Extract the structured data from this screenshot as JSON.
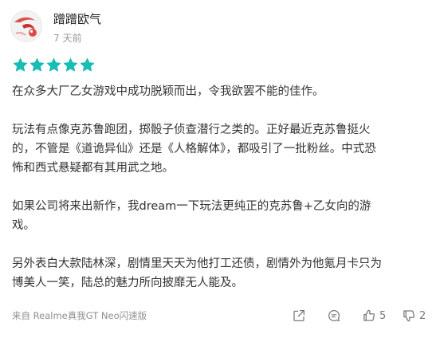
{
  "review": {
    "username": "蹭蹭欧气",
    "time": "7 天前",
    "rating": 5,
    "star_color": "#19bdb5",
    "paragraphs": [
      "在众多大厂乙女游戏中成功脱颖而出，令我欲罢不能的佳作。",
      "玩法有点像克苏鲁跑团，掷骰子侦查潜行之类的。正好最近克苏鲁挺火\n的，不管是《道诡异仙》还是《人格解体》，都吸引了一批粉丝。中式恐\n怖和西式悬疑都有其用武之地。",
      "如果公司将来出新作，我dream一下玩法更纯正的克苏鲁+乙女向的游\n戏。",
      "另外表白大款陆林深，剧情里天天为他打工还债，剧情外为他氪月卡只为\n博美人一笑，陆总的魅力所向披靡无人能及。"
    ],
    "device": "来自 Realme真我GT Neo闪速版",
    "actions": {
      "share_icon": "share-icon",
      "comment_icon": "comment-icon",
      "like_count": "5",
      "dislike_count": "2"
    }
  }
}
